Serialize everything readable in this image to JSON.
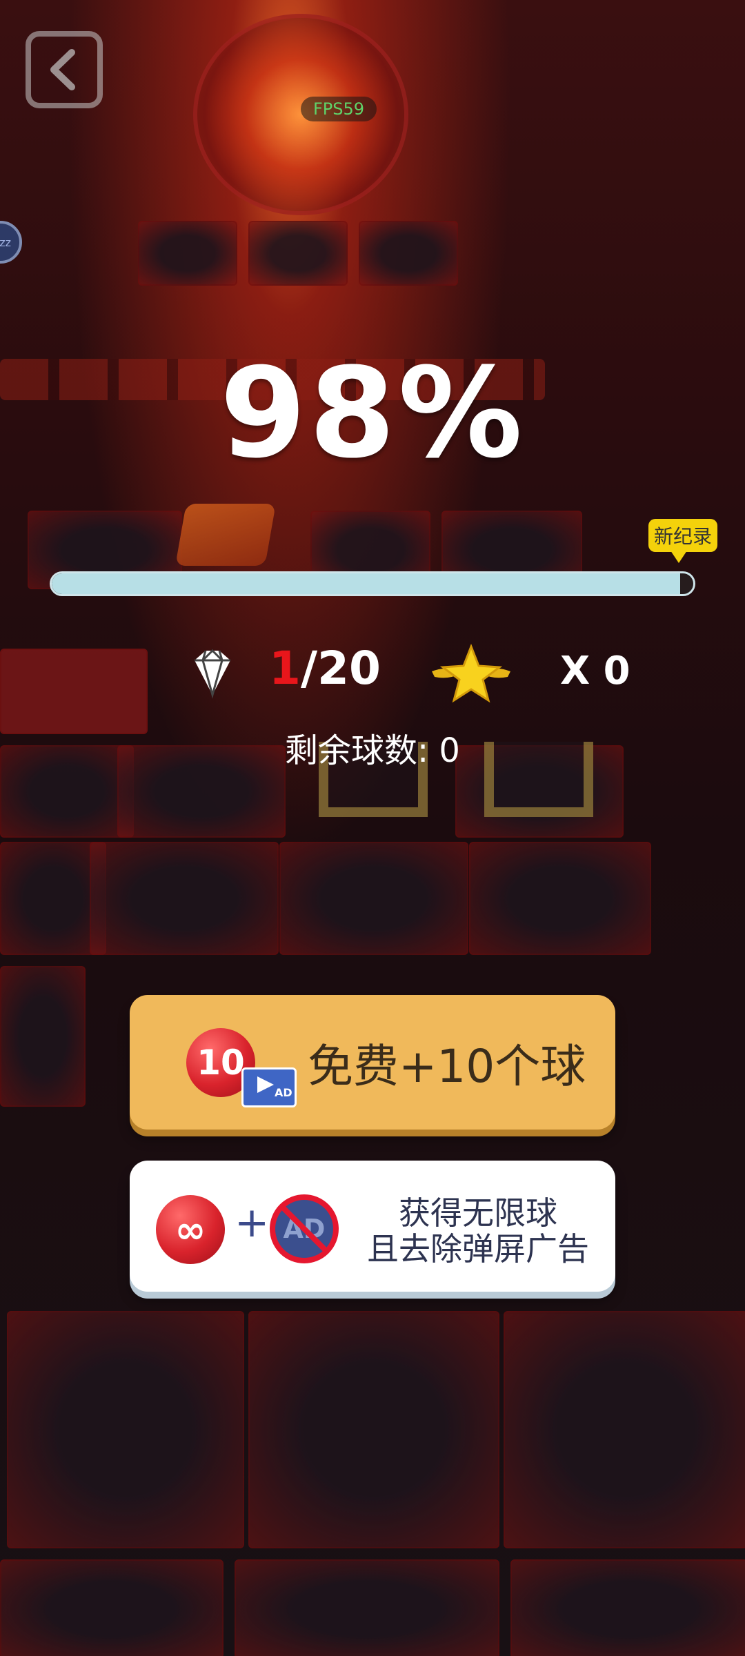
{
  "hud": {
    "fps": "FPS59",
    "side_chip": "zz"
  },
  "level": {
    "progress_text": "98%",
    "progress_value": 0.98,
    "new_record_label": "新纪录"
  },
  "stats": {
    "gems_current": "1",
    "gems_total": "/20",
    "stars_multiplier": "X 0",
    "balls_remaining_label": "剩余球数: 0"
  },
  "buttons": {
    "free_balls": {
      "ball_count": "10",
      "ad_tag": "AD",
      "label": "免费+10个球"
    },
    "unlimited": {
      "infinity_symbol": "∞",
      "plus": "+",
      "no_ad_text": "AD",
      "line1": "获得无限球",
      "line2": "且去除弹屏广告"
    }
  },
  "icons": {
    "back": "back-arrow-icon",
    "gem": "diamond-icon",
    "star": "winged-star-icon",
    "no_ad": "no-ad-icon",
    "video": "video-ad-icon"
  },
  "colors": {
    "progress_fill": "#b7dfe6",
    "gem_current": "#e8161b",
    "free_button": "#f0b95b",
    "record_tag": "#f4d20b",
    "fps_text": "#5fd36a"
  }
}
